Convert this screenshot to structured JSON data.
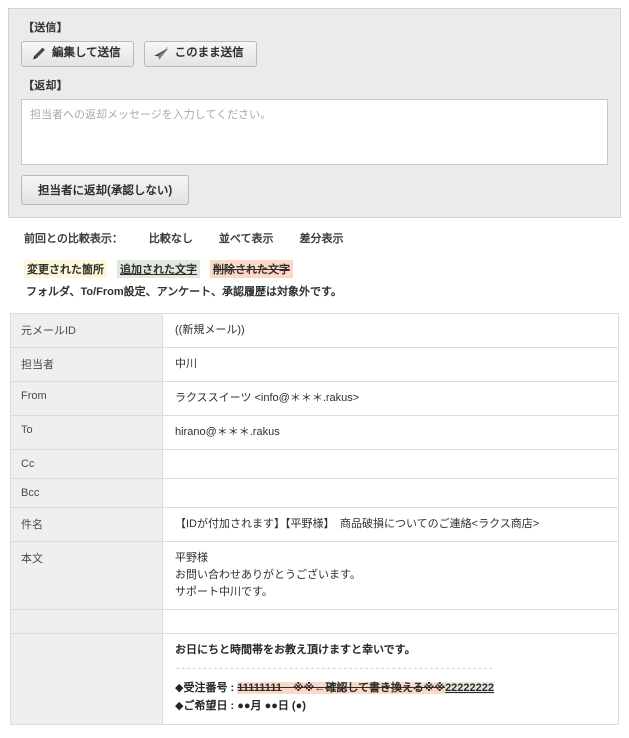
{
  "action_panel": {
    "send_section_label": "【送信】",
    "buttons": [
      {
        "id": "edit-and-send",
        "label": "編集して送信",
        "icon": "pencil-icon"
      },
      {
        "id": "send-as-is",
        "label": "このまま送信",
        "icon": "paper-plane-icon"
      }
    ],
    "reply_section_label": "【返却】",
    "reply_textarea": {
      "value": "",
      "placeholder": "担当者への返却メッセージを入力してください。"
    },
    "return_button_label": "担当者に返却(承認しない)"
  },
  "compare": {
    "label": "前回との比較表示：",
    "options": [
      {
        "id": "no-compare",
        "label": "比較なし"
      },
      {
        "id": "side-by-side",
        "label": "並べて表示"
      },
      {
        "id": "diff-view",
        "label": "差分表示"
      }
    ],
    "legend": [
      {
        "id": "changed",
        "label": "変更された箇所",
        "color": "#fdf6d8"
      },
      {
        "id": "added",
        "label": "追加された文字",
        "color": "#dfeadd"
      },
      {
        "id": "deleted",
        "label": "削除された文字",
        "color": "#fbd9c6"
      }
    ],
    "note": "フォルダ、To/From設定、アンケート、承認履歴は対象外です。"
  },
  "detail": {
    "rows": [
      {
        "label": "元メールID",
        "value": "((新規メール))"
      },
      {
        "label": "担当者",
        "value": "中川"
      },
      {
        "label": "From",
        "value": "ラクススイーツ <info@＊＊＊.rakus>"
      },
      {
        "label": "To",
        "value": "hirano@＊＊＊.rakus"
      },
      {
        "label": "Cc",
        "value": ""
      },
      {
        "label": "Bcc",
        "value": ""
      },
      {
        "label": "件名",
        "value": "【IDが付加されます】【平野様】　商品破損についてのご連絡<ラクス商店>"
      },
      {
        "label": "本文",
        "value": "平野様\nお問い合わせありがとうございます。\nサポート中川です。"
      }
    ],
    "spacer_row": {
      "label": "",
      "value": ""
    },
    "tail_row": {
      "label": "",
      "heading": "お日にちと時間帯をお教え頂けますと幸いです。",
      "rule": "-----------------------------------------------------------",
      "order_line": {
        "prefix": "◆受注番号 : ",
        "deleted": "11111111　※※←確認して書き換える※※",
        "added": "22222222"
      },
      "date_line": "◆ご希望日 : ●●月 ●●日 (●)"
    }
  }
}
